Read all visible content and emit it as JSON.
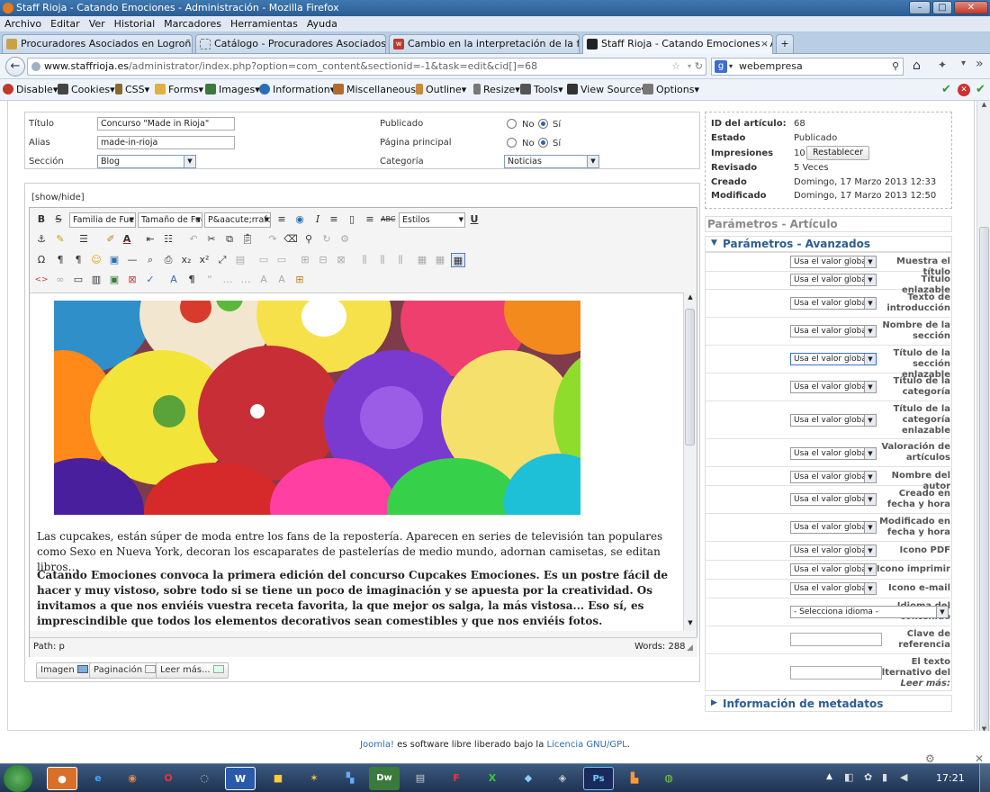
{
  "window": {
    "title": "Staff Rioja - Catando Emociones - Administración - Mozilla Firefox"
  },
  "menu": [
    "Archivo",
    "Editar",
    "Ver",
    "Historial",
    "Marcadores",
    "Herramientas",
    "Ayuda"
  ],
  "tabs": [
    {
      "label": "Procuradores Asociados en Logroño (..."
    },
    {
      "label": "Catálogo - Procuradores Asociados e..."
    },
    {
      "label": "Cambio en la interpretación de la fec..."
    },
    {
      "label": "Staff Rioja - Catando Emociones - Ad..."
    }
  ],
  "url": {
    "host": "www.staffrioja.es",
    "path": "/administrator/index.php?option=com_content&sectionid=-1&task=edit&cid[]=68"
  },
  "search": {
    "engine": "g",
    "value": "webempresa"
  },
  "devbar": [
    "Disable",
    "Cookies",
    "CSS",
    "Forms",
    "Images",
    "Information",
    "Miscellaneous",
    "Outline",
    "Resize",
    "Tools",
    "View Source",
    "Options"
  ],
  "form": {
    "titulo_label": "Título",
    "titulo": "Concurso \"Made in Rioja\"",
    "alias_label": "Alias",
    "alias": "made-in-rioja",
    "seccion_label": "Sección",
    "seccion": "Blog",
    "publicado_label": "Publicado",
    "portada_label": "Página principal",
    "categoria_label": "Categoría",
    "categoria": "Noticias",
    "no": "No",
    "si": "Sí"
  },
  "article_info": {
    "id_label": "ID del artículo:",
    "id": "68",
    "estado_label": "Estado",
    "estado": "Publicado",
    "impresiones_label": "Impresiones",
    "impresiones": "10",
    "reset": "Restablecer",
    "revisado_label": "Revisado",
    "revisado": "5 Veces",
    "creado_label": "Creado",
    "creado": "Domingo, 17 Marzo 2013 12:33",
    "modificado_label": "Modificado",
    "modificado": "Domingo, 17 Marzo 2013 12:50"
  },
  "editor": {
    "showhide": "[show/hide]",
    "font_family": "Familia de Fuer",
    "font_size": "Tamaño de Fue",
    "format": "P&aacute;rrafo",
    "styles": "Estilos",
    "paragraph1": "Las cupcakes, están súper de moda entre los fans de la repostería. Aparecen en series de televisión tan populares como Sexo en Nueva York, decoran los escaparates de pastelerías de medio mundo, adornan camisetas, se editan libros…",
    "paragraph2": "Catando Emociones convoca la primera edición del concurso Cupcakes Emociones. Es un postre fácil de hacer y muy vistoso, sobre todo si se tiene un poco de imaginación y se apuesta por la creatividad. Os invitamos a que nos enviéis vuestra receta favorita, la que mejor os salga, la más vistosa... Eso sí, es imprescindible que todos los elementos decorativos sean comestibles y que nos enviéis fotos.",
    "path": "Path: p",
    "words": "Words: 288",
    "buttons": [
      "Imagen",
      "Paginación",
      "Leer más..."
    ]
  },
  "params": {
    "panel_title": "Parámetros - Artículo",
    "advanced_title": "Parámetros - Avanzados",
    "default": "Usa el valor global",
    "rows": [
      "Muestra el título",
      "Título enlazable",
      "Texto de introducción",
      "Nombre de la sección",
      "Título de la sección enlazable",
      "Título de la categoría",
      "Título de la categoría enlazable",
      "Valoración de artículos",
      "Nombre del autor",
      "Creado en fecha y hora",
      "Modificado en fecha y hora",
      "Icono PDF",
      "Icono imprimir",
      "Icono e-mail"
    ],
    "idioma_label": "Idioma del contenido",
    "idioma": "- Selecciona idioma -",
    "clave_label": "Clave de referencia",
    "alt_label": "El texto alternativo del",
    "alt_label2": "Leer más:",
    "metadata_title": "Información de metadatos"
  },
  "footer": {
    "joomla": "Joomla!",
    "text": " es software libre liberado bajo la ",
    "license": "Licencia GNU/GPL",
    "dot": "."
  },
  "taskbar": {
    "clock": "17:21",
    "apps": [
      "W",
      "Dw",
      "Ps"
    ]
  },
  "colors": {
    "link": "#2a6fb3",
    "panel_title": "#2c5d92",
    "accent": "#2d5fb5"
  }
}
